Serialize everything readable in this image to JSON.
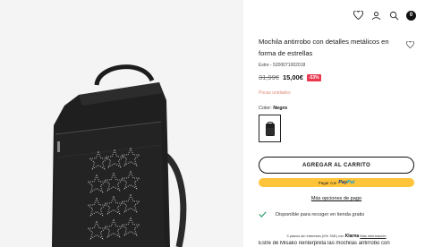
{
  "header": {
    "icons": [
      "heart-icon",
      "user-icon",
      "search-icon",
      "cart-icon"
    ],
    "cart_count": "0"
  },
  "product": {
    "title": "Mochila antirrobo con detalles metálicos en forma de estrellas",
    "reference": "Estre - 5200071002018",
    "old_price": "31,99€",
    "new_price": "15,00€",
    "discount": "-53%",
    "stock_note": "Pocas unidades",
    "color_label": "Color:",
    "color_value": "Negro"
  },
  "actions": {
    "add_to_cart": "AGREGAR AL CARRITO",
    "paypal_prefix": "Pagar con",
    "paypal_brand_a": "Pay",
    "paypal_brand_b": "Pal",
    "more_payment": "Más opciones de pago"
  },
  "pickup": {
    "text": "Disponible para recoger en tienda gratis"
  },
  "klarna": {
    "text": "3 plazos sin intereses (0% TAE) con",
    "brand": "Klarna",
    "link": "Más información"
  },
  "description_preview": "Estre de Misako reinterpreta las mochilas antirrobo con",
  "colors": {
    "accent_discount": "#e9374e",
    "paypal_yellow": "#ffc439",
    "stock_text": "#e08a7a",
    "pickup_check": "#2e9e6a"
  }
}
